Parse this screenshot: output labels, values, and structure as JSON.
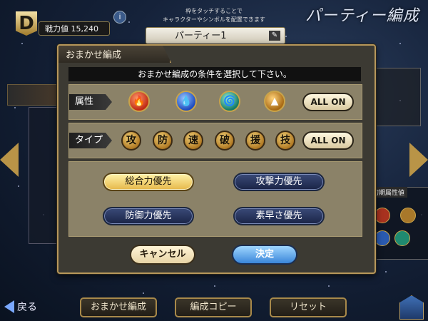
{
  "screen_title": "パーティー編成",
  "header": {
    "rank": "D",
    "power": "戦力値 15,240",
    "info_icon": "i",
    "hint_line1": "枠をタッチすることで",
    "hint_line2": "キャラクターやシンボルを配置できます",
    "party_name": "パーティー1"
  },
  "dialog": {
    "title": "おまかせ編成",
    "instruction": "おまかせ編成の条件を選択して下さい。",
    "attribute": {
      "label": "属性",
      "orbs": [
        {
          "name": "fire",
          "color": "#e0402a"
        },
        {
          "name": "water",
          "color": "#3a7ae8"
        },
        {
          "name": "wind",
          "color": "#2aa890"
        },
        {
          "name": "earth",
          "color": "#d99a2a"
        }
      ],
      "all_on": "ALL ON"
    },
    "type": {
      "label": "タイプ",
      "items": [
        "攻",
        "防",
        "速",
        "破",
        "援",
        "技"
      ],
      "all_on": "ALL ON"
    },
    "priority": {
      "total": "総合力優先",
      "attack": "攻撃力優先",
      "defense": "防御力優先",
      "speed": "素早さ優先",
      "selected": "total"
    },
    "cancel": "キャンセル",
    "confirm": "決定"
  },
  "side_panel": {
    "initial_attr": "初期属性値"
  },
  "bottom": {
    "back": "戻る",
    "auto_form": "おまかせ編成",
    "copy_form": "編成コピー",
    "reset": "リセット"
  },
  "colors": {
    "gold_border": "#b7975a",
    "dialog_bg": "#3c3a33",
    "section_bg": "#8b8268"
  }
}
